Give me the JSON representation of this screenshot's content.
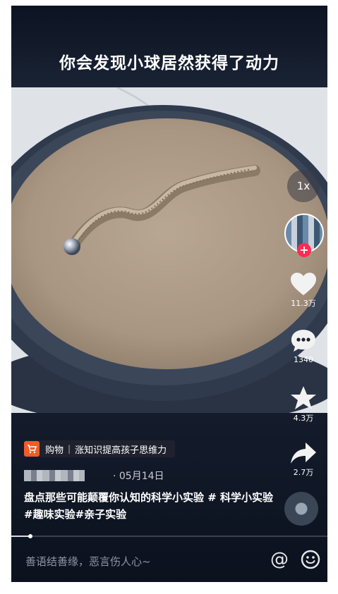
{
  "caption": "你会发现小球居然获得了动力",
  "speed": "1x",
  "actions": {
    "like_count": "11.3万",
    "comment_count": "1340",
    "favorite_count": "4.3万",
    "share_count": "2.7万"
  },
  "follow_badge": "+",
  "shop": {
    "label": "购物",
    "separator": "|",
    "name": "涨知识提高孩子思维力"
  },
  "post": {
    "date": "· 05月14日",
    "description": "盘点那些可能颠覆你认知的科学小实验 # 科学小实验 #趣味实验#亲子实验",
    "progress": 0.06
  },
  "comment": {
    "placeholder": "善语结善缘，恶言伤人心~",
    "at_label": "@"
  },
  "colors": {
    "accent_red": "#fe2c55",
    "cart_orange": "#f35b28",
    "background": "#0f1624"
  },
  "icons": [
    "heart-icon",
    "comment-icon",
    "star-icon",
    "share-icon",
    "cart-icon",
    "at-icon",
    "emoji-icon"
  ]
}
